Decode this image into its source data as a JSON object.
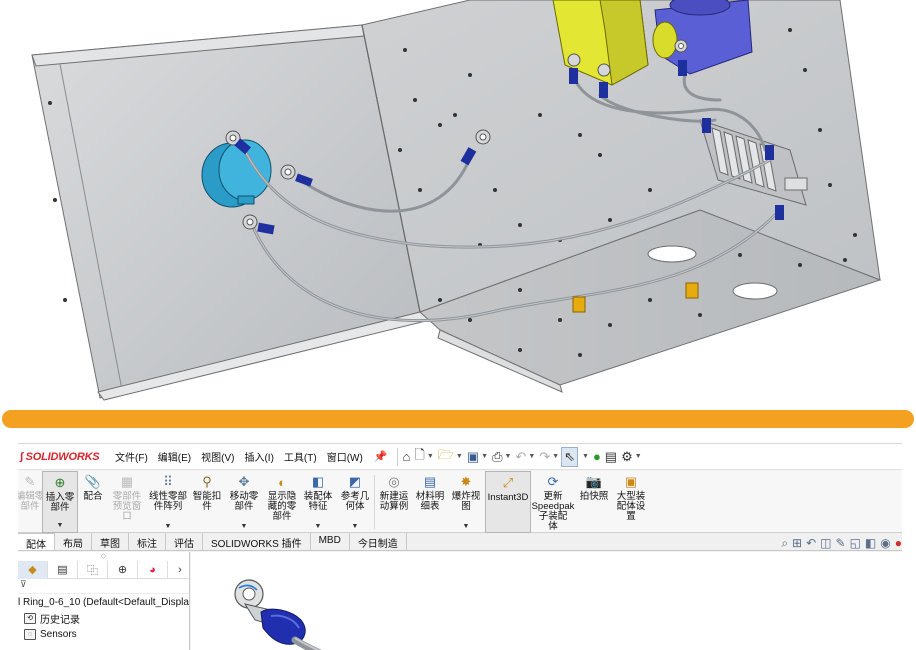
{
  "menubar": {
    "logo": "SOLIDWORKS",
    "items": [
      "文件(F)",
      "编辑(E)",
      "视图(V)",
      "插入(I)",
      "工具(T)",
      "窗口(W)"
    ]
  },
  "ribbon": {
    "buttons": [
      {
        "label": "编辑零\n部件",
        "icon": "edit-component-icon",
        "dim": true
      },
      {
        "label": "插入零\n部件",
        "icon": "insert-component-icon"
      },
      {
        "label": "配合",
        "icon": "mate-icon"
      },
      {
        "label": "零部件\n预览窗\n口",
        "icon": "component-preview-icon",
        "dim": true
      },
      {
        "label": "线性零部\n件阵列",
        "icon": "linear-pattern-icon"
      },
      {
        "label": "智能扣\n件",
        "icon": "smart-fastener-icon"
      },
      {
        "label": "移动零\n部件",
        "icon": "move-component-icon"
      },
      {
        "label": "显示隐\n藏的零\n部件",
        "icon": "show-hidden-icon"
      },
      {
        "label": "装配体\n特征",
        "icon": "assembly-feature-icon"
      },
      {
        "label": "参考几\n何体",
        "icon": "reference-geometry-icon"
      },
      {
        "label": "新建运\n动算例",
        "icon": "motion-study-icon"
      },
      {
        "label": "材料明\n细表",
        "icon": "bom-icon"
      },
      {
        "label": "爆炸视\n图",
        "icon": "exploded-view-icon"
      },
      {
        "label": "Instant3D",
        "icon": "instant3d-icon"
      },
      {
        "label": "更新\nSpeedpak\n子装配\n体",
        "icon": "speedpak-icon"
      },
      {
        "label": "拍快照",
        "icon": "snapshot-icon"
      },
      {
        "label": "大型装\n配体设\n置",
        "icon": "large-assembly-icon"
      }
    ]
  },
  "tabs": [
    "配体",
    "布局",
    "草图",
    "标注",
    "评估",
    "SOLIDWORKS 插件",
    "MBD",
    "今日制造"
  ],
  "tree": {
    "root": "l Ring_0-6_10  (Default<Default_Displa",
    "history": "历史记录",
    "sensors": "Sensors"
  },
  "colors": {
    "accent": "#f4a020",
    "logo": "#d8242f",
    "panel": "#c8cacc",
    "terminal_blue": "#1e2f9e",
    "yellow_part": "#e3e632",
    "purple_part": "#5b5fd6",
    "round_part": "#2a9cc7"
  }
}
